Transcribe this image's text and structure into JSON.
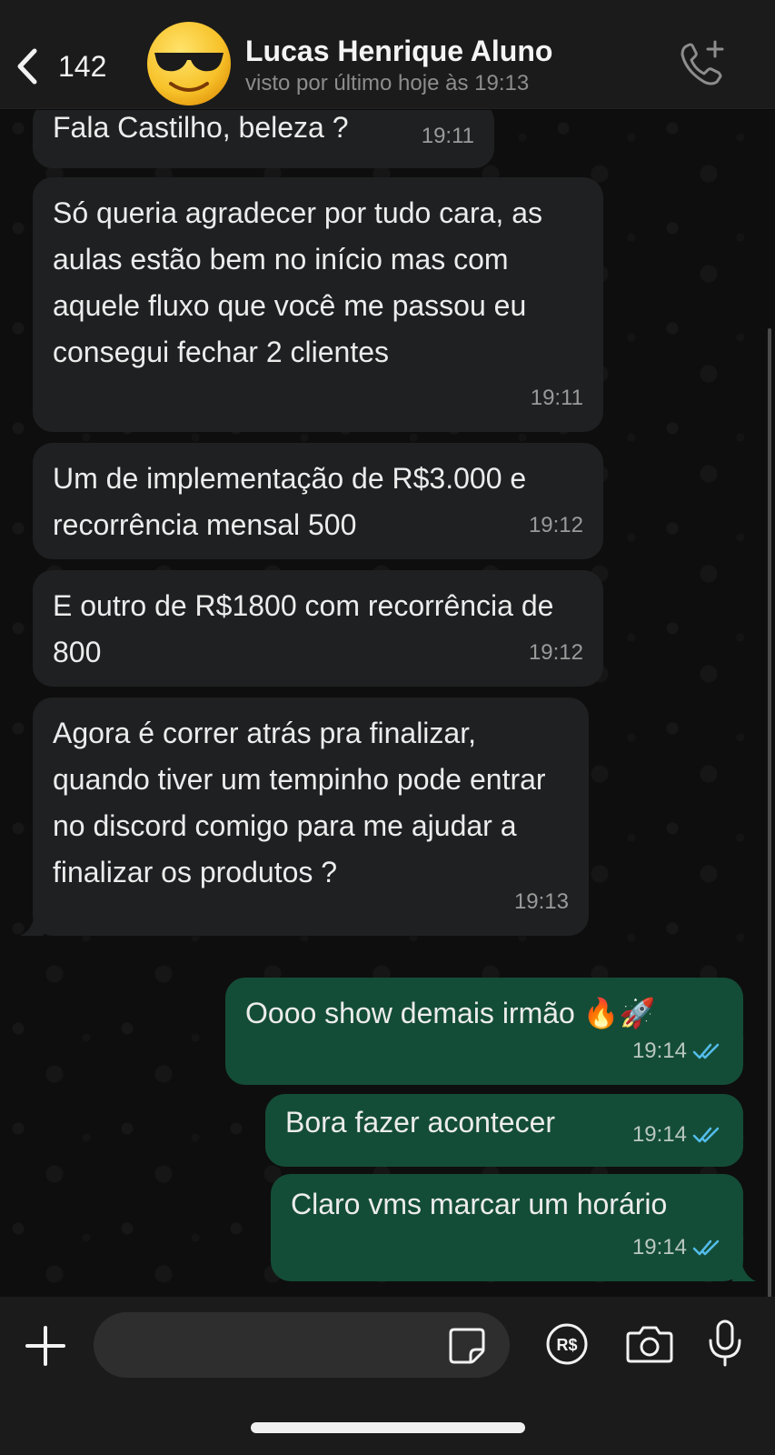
{
  "header": {
    "back_count": "142",
    "contact_name": "Lucas Henrique Aluno",
    "status": "visto por último hoje às 19:13",
    "avatar_emoji": "😎"
  },
  "messages": [
    {
      "dir": "in",
      "text": "Fala Castilho, beleza ?",
      "time": "19:11"
    },
    {
      "dir": "in",
      "text": "Só queria agradecer por tudo cara, as aulas estão bem no início mas com aquele fluxo que você me passou eu consegui fechar 2 clientes",
      "time": "19:11"
    },
    {
      "dir": "in",
      "text": "Um de implementação de R$3.000 e recorrência mensal 500",
      "time": "19:12"
    },
    {
      "dir": "in",
      "text": "E outro de R$1800 com recorrência de 800",
      "time": "19:12"
    },
    {
      "dir": "in",
      "text": "Agora é correr atrás pra finalizar, quando tiver um tempinho pode entrar no discord comigo para me ajudar a finalizar os produtos ?",
      "time": "19:13"
    },
    {
      "dir": "out",
      "text": "Oooo show demais irmão 🔥🚀",
      "time": "19:14",
      "read": true
    },
    {
      "dir": "out",
      "text": "Bora fazer acontecer",
      "time": "19:14",
      "read": true
    },
    {
      "dir": "out",
      "text": "Claro vms marcar um horário",
      "time": "19:14",
      "read": true
    }
  ],
  "composer": {
    "placeholder": ""
  },
  "icons": {
    "back": "chevron-left-icon",
    "call": "phone-add-icon",
    "attach": "plus-icon",
    "sticker": "sticker-icon",
    "pay": "brl-payment-icon",
    "camera": "camera-icon",
    "mic": "microphone-icon"
  },
  "colors": {
    "incoming_bubble": "#1f2021",
    "outgoing_bubble": "#144d37",
    "read_ticks": "#53bdeb",
    "header_bg": "#1b1b1b"
  }
}
